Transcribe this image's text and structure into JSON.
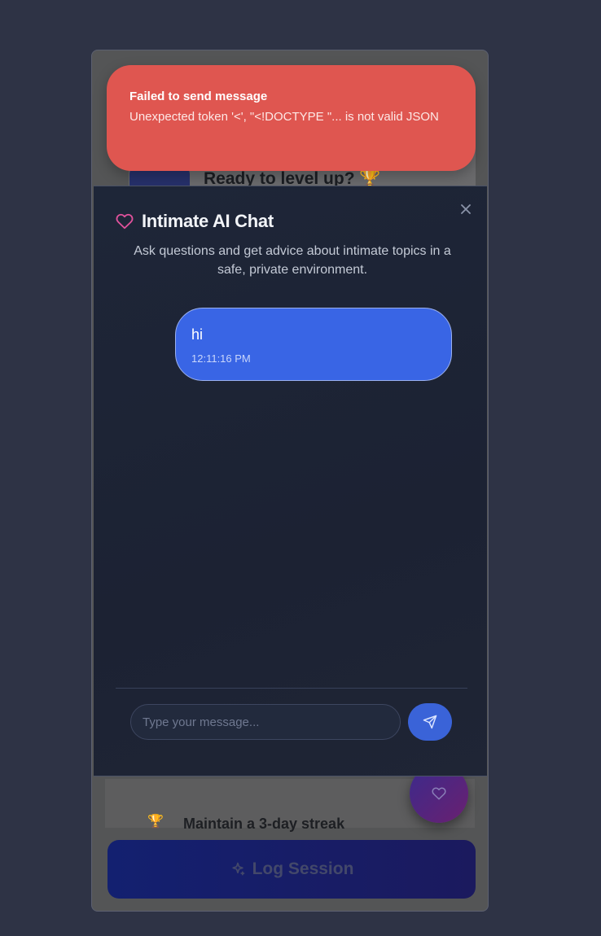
{
  "background": {
    "card_title": "Ready to level up? 🏆",
    "streak_text": "Maintain a 3-day streak",
    "log_session_label": "Log Session"
  },
  "toast": {
    "title": "Failed to send message",
    "message": "Unexpected token '<', \"<!DOCTYPE \"... is not valid JSON"
  },
  "dialog": {
    "title": "Intimate AI Chat",
    "description": "Ask questions and get advice about intimate topics in a safe, private environment.",
    "messages": [
      {
        "text": "hi",
        "time": "12:11:16 PM"
      }
    ],
    "input": {
      "placeholder": "Type your message...",
      "value": ""
    }
  },
  "icons": {
    "title": "heart-icon",
    "close": "close-icon",
    "send": "send-icon",
    "fab": "heart-icon",
    "log": "sparkles-icon",
    "streak": "trophy-icon"
  },
  "colors": {
    "toast_bg": "#df5650",
    "bubble_bg": "#3965e5",
    "accent_pink": "#e0529c",
    "send_bg": "#3a63d8"
  }
}
